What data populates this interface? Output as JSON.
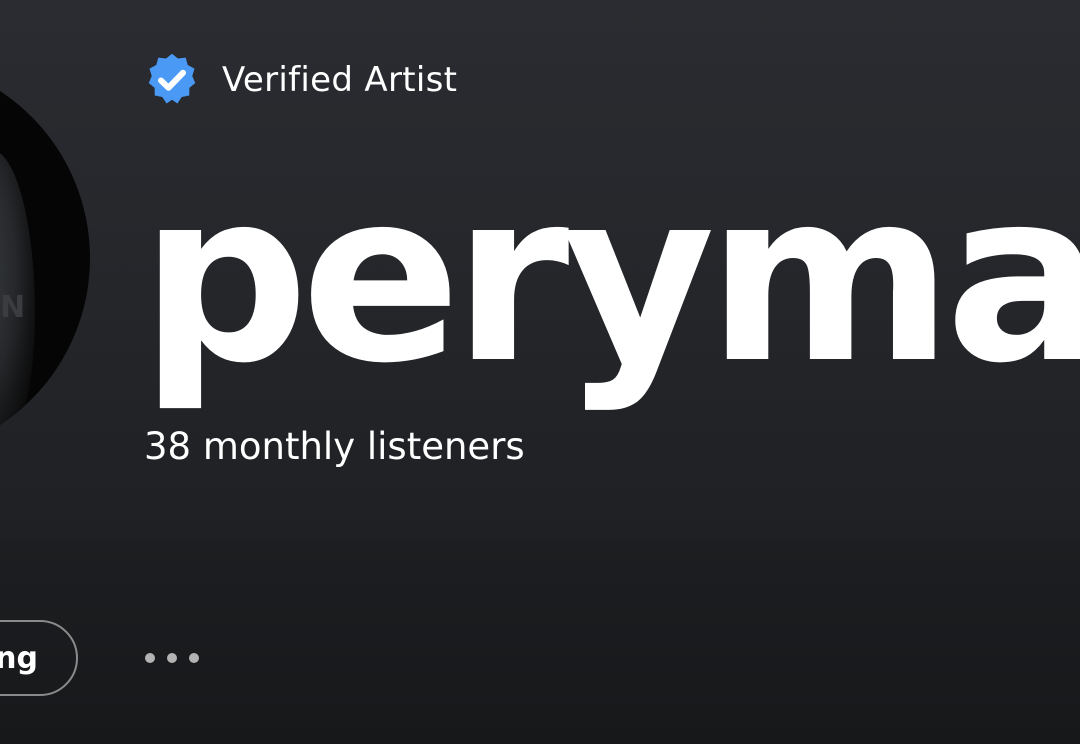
{
  "header": {
    "verified_label": "Verified Artist",
    "artist_name": "perymay",
    "monthly_listeners": "38 monthly listeners"
  },
  "avatar": {
    "text": "N"
  },
  "actions": {
    "follow_label": "Following",
    "more_icon": "more-options-icon"
  },
  "colors": {
    "verified_badge": "#4a9af5",
    "text": "#ffffff",
    "button_border": "#8a8a8a"
  }
}
